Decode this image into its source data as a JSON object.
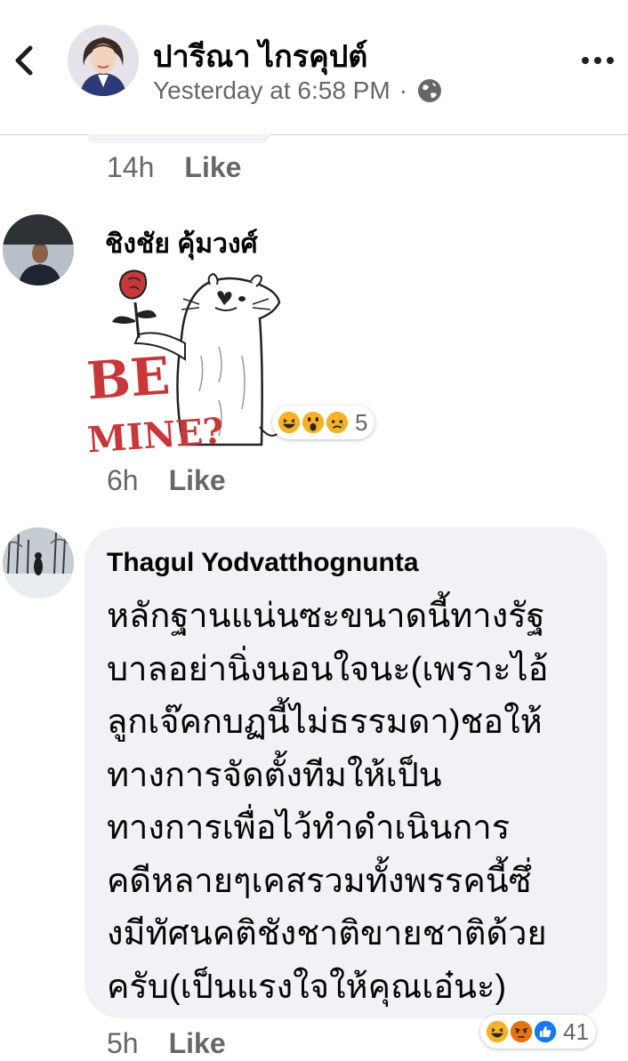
{
  "header": {
    "name": "ปารีณา ไกรคุปต์",
    "time": "Yesterday at 6:58 PM",
    "separator": "·",
    "privacy_icon": "globe-icon",
    "back_icon": "chevron-left-icon",
    "more_icon": "more-horizontal-icon"
  },
  "comments": [
    {
      "time": "14h",
      "like_label": "Like"
    },
    {
      "author": "ชิงชัย คุ้มวงศ์",
      "sticker_text": [
        "BE",
        "MINE?"
      ],
      "reactions": [
        "laugh",
        "wow",
        "sad"
      ],
      "reaction_count": "5",
      "time": "6h",
      "like_label": "Like"
    },
    {
      "author": "Thagul Yodvatthognunta",
      "lines": [
        "หลักฐานแน่นซะขนาดนี้ทางรัฐ",
        "บาลอย่านิ่งนอนใจนะ(เพราะไอ้",
        "ลูกเจ๊คกบฏนี้ไม่ธรรมดา)ชอให้",
        "ทางการจัดตั้งทีมให้เป็น",
        "ทางการเพื่อไว้ทำดำเนินการ",
        "คดีหลายๆเคสรวมทั้งพรรคนี้ซึ่",
        "งมีทัศนคติชังชาติขายชาติด้วย",
        "ครับ(เป็นแรงใจให้คุณเอ๋นะ)"
      ],
      "reactions": [
        "laugh",
        "angry",
        "like"
      ],
      "reaction_count": "41",
      "time": "5h",
      "like_label": "Like"
    }
  ],
  "colors": {
    "laugh": "#f7b125",
    "wow": "#f7b125",
    "sad": "#f7b125",
    "angry": "#e9710f",
    "like": "#1877f2",
    "meta_text": "#65676b",
    "bubble_bg": "#f0f2f5"
  }
}
